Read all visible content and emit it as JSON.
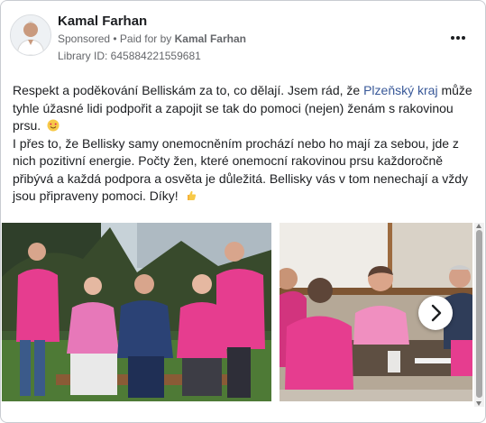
{
  "post": {
    "author": "Kamal Farhan",
    "sponsored": "Sponsored",
    "separator": " • ",
    "paid_for_prefix": "Paid for by ",
    "paid_for_name": "Kamal Farhan",
    "library_id": "Library ID: 645884221559681",
    "text": {
      "p1_before_link": "Respekt a poděkování Belliskám za to, co dělají. Jsem rád, že ",
      "p1_link": "Plzeňský kraj",
      "p1_after_link": " může tyhle úžasné lidi podpořit a zapojit se tak do pomoci (nejen) ženám s rakovinou prsu.",
      "p2": "I přes to, že Bellisky samy onemocněním prochází nebo ho mají za sebou, jde z nich pozitivní energie. Počty žen, které onemocní rakovinou prsu každoročně přibývá a každá podpora a osvěta je důležitá. Bellisky vás v tom nenechají a vždy jsou připraveny pomoci. Díky!"
    }
  },
  "icons": {
    "avatar": "avatar-photo",
    "more": "more-options-icon",
    "emoji1": "smiling-face-with-heart-eyes-emoji",
    "emoji2": "thumbs-up-emoji",
    "next": "chevron-right-icon"
  },
  "colors": {
    "text": "#1c1e21",
    "secondary_text": "#65676b",
    "link": "#385898",
    "border": "#c9ccd1",
    "pink": "#e63d8f"
  }
}
